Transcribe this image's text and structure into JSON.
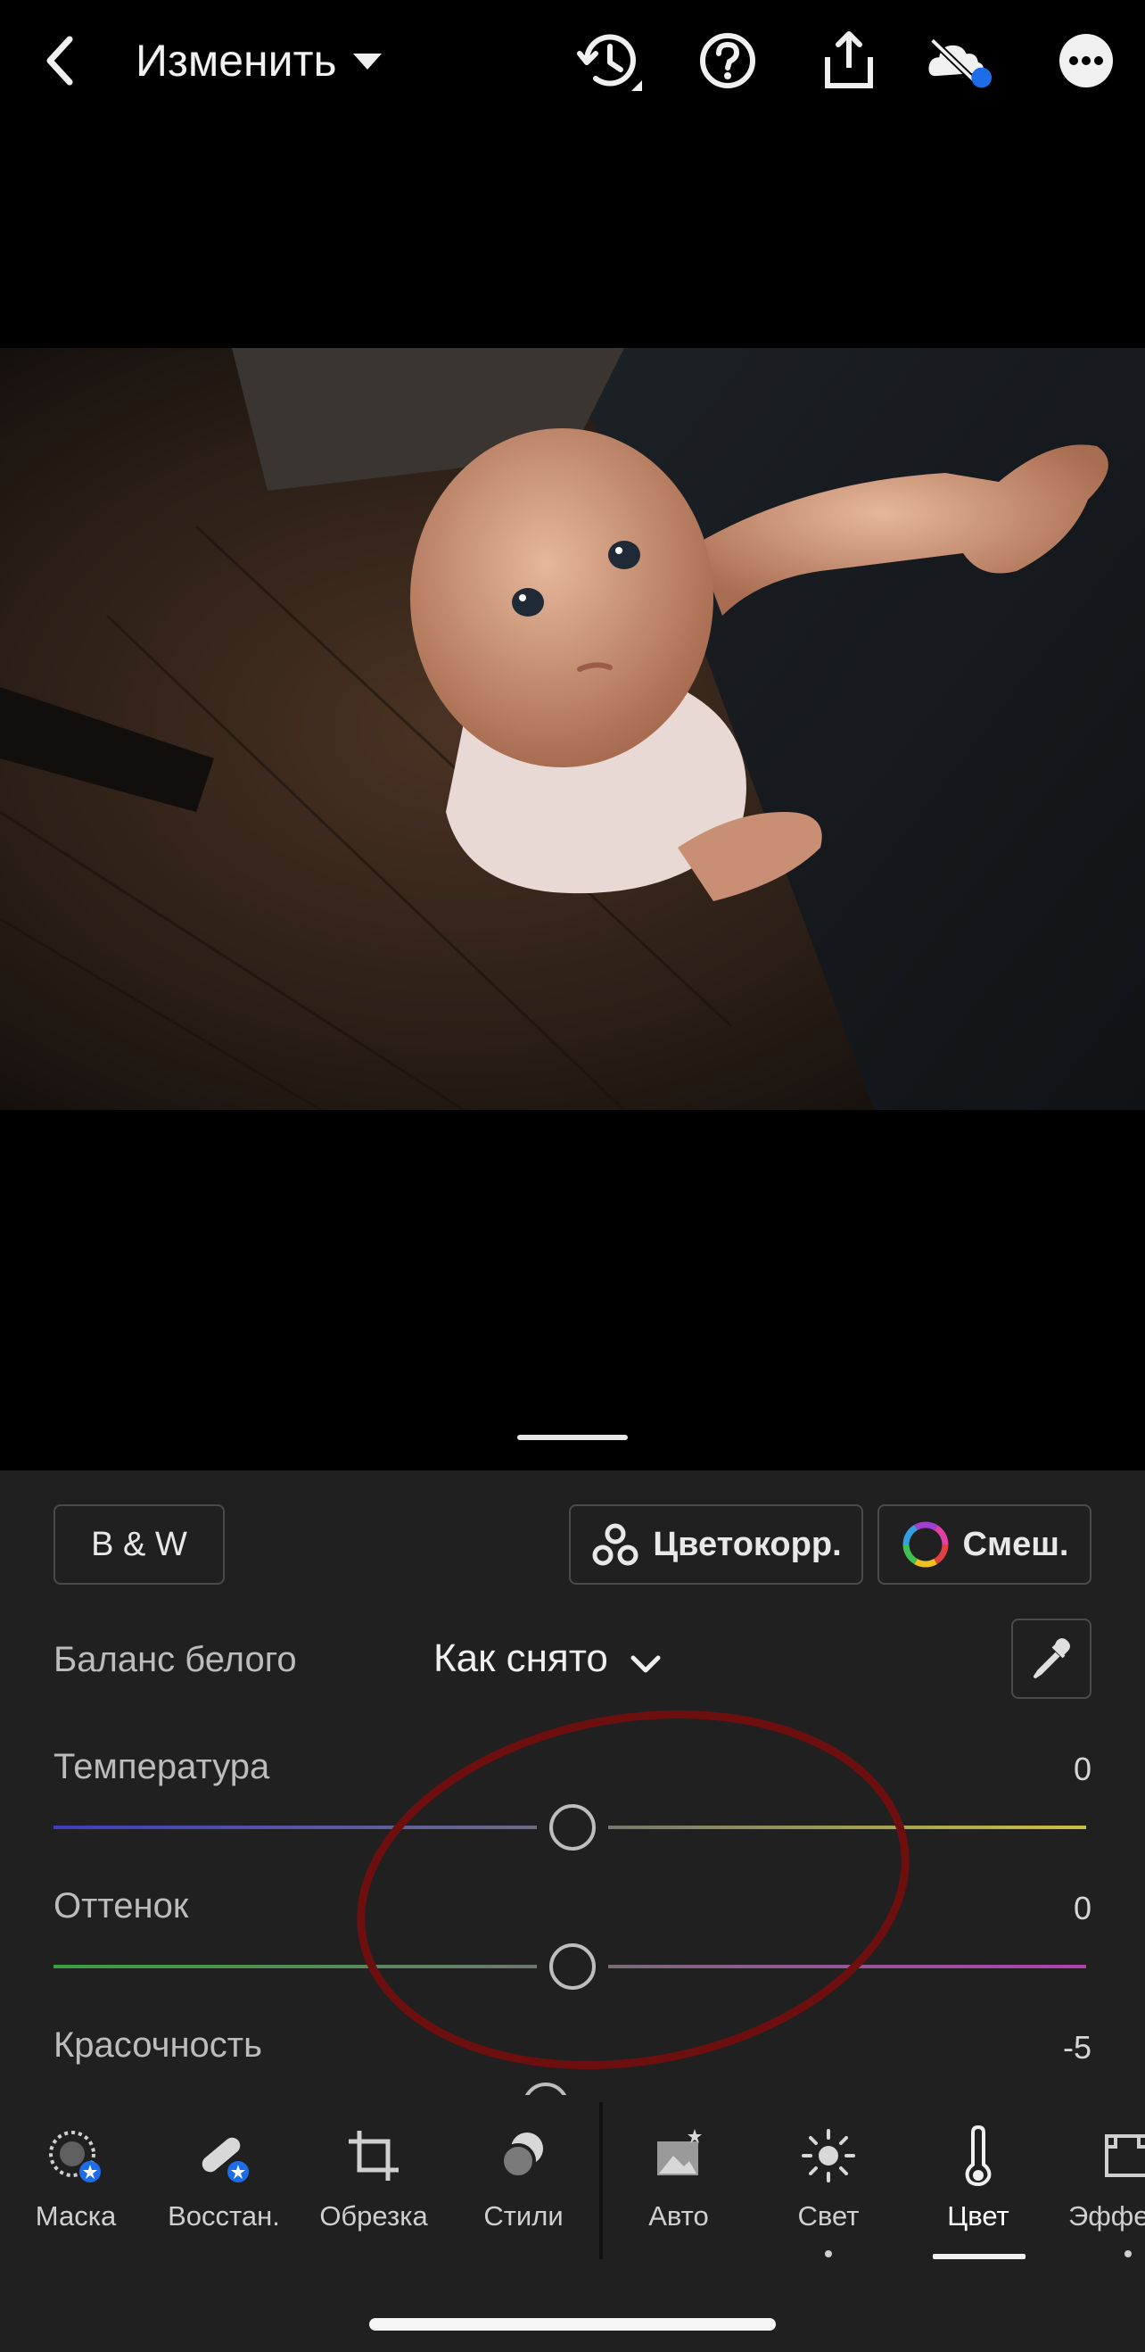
{
  "header": {
    "title": "Изменить"
  },
  "panel": {
    "bw_label": "B & W",
    "grading_label": "Цветокорр.",
    "mix_label": "Смеш.",
    "white_balance": {
      "label": "Баланс белого",
      "value": "Как снято"
    },
    "sliders": [
      {
        "label": "Температура",
        "value": "0"
      },
      {
        "label": "Оттенок",
        "value": "0"
      },
      {
        "label": "Красочность",
        "value": "-5"
      }
    ]
  },
  "toolbar": {
    "items": [
      {
        "label": "Маска",
        "icon": "mask-icon"
      },
      {
        "label": "Восстан.",
        "icon": "healing-icon"
      },
      {
        "label": "Обрезка",
        "icon": "crop-icon"
      },
      {
        "label": "Стили",
        "icon": "presets-icon"
      },
      {
        "label": "Авто",
        "icon": "auto-icon"
      },
      {
        "label": "Свет",
        "icon": "light-icon"
      },
      {
        "label": "Цвет",
        "icon": "color-thermometer-icon"
      },
      {
        "label": "Эффекты",
        "icon": "effects-icon"
      }
    ],
    "active": "Цвет"
  },
  "colors": {
    "panel_bg": "#202020",
    "annotation_ellipse": "#6e0f0f",
    "sync_badge": "#1d6de8"
  }
}
